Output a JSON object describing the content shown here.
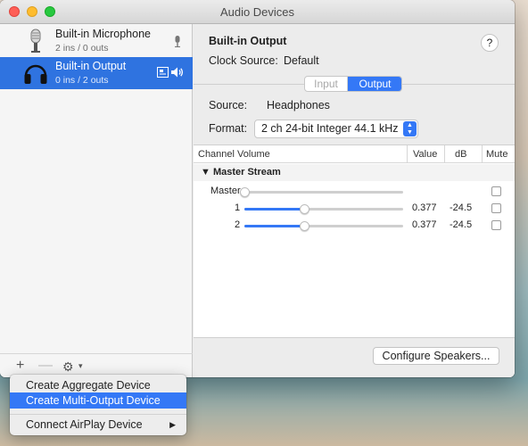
{
  "window": {
    "title": "Audio Devices"
  },
  "devices": [
    {
      "name": "Built-in Microphone",
      "io": "2 ins / 0 outs",
      "icon": "microphone-icon",
      "selected": false
    },
    {
      "name": "Built-in Output",
      "io": "0 ins / 2 outs",
      "icon": "headphones-icon",
      "selected": true
    }
  ],
  "sidebar_footer": {
    "add": "+",
    "remove": "—"
  },
  "detail": {
    "device_title": "Built-in Output",
    "help": "?",
    "clock_source_label": "Clock Source:",
    "clock_source_value": "Default",
    "tabs": [
      "Input",
      "Output"
    ],
    "active_tab": "Output",
    "source_label": "Source:",
    "source_value": "Headphones",
    "format_label": "Format:",
    "format_value": "2 ch 24-bit Integer 44.1 kHz"
  },
  "channel_table": {
    "headers": {
      "channel": "Channel Volume",
      "value": "Value",
      "db": "dB",
      "mute": "Mute"
    },
    "stream_label": "Master Stream",
    "rows": [
      {
        "label": "Master",
        "level": 0,
        "value": "",
        "db": "",
        "mute": false
      },
      {
        "label": "1",
        "level": 0.377,
        "value": "0.377",
        "db": "-24.5",
        "mute": false
      },
      {
        "label": "2",
        "level": 0.377,
        "value": "0.377",
        "db": "-24.5",
        "mute": false
      }
    ]
  },
  "configure_button": "Configure Speakers...",
  "context_menu": {
    "items": [
      {
        "label": "Create Aggregate Device",
        "selected": false
      },
      {
        "label": "Create Multi-Output Device",
        "selected": true
      },
      {
        "label": "Connect AirPlay Device",
        "selected": false,
        "submenu": true
      }
    ]
  },
  "colors": {
    "accent": "#3478f6",
    "selection": "#2f73e0"
  }
}
